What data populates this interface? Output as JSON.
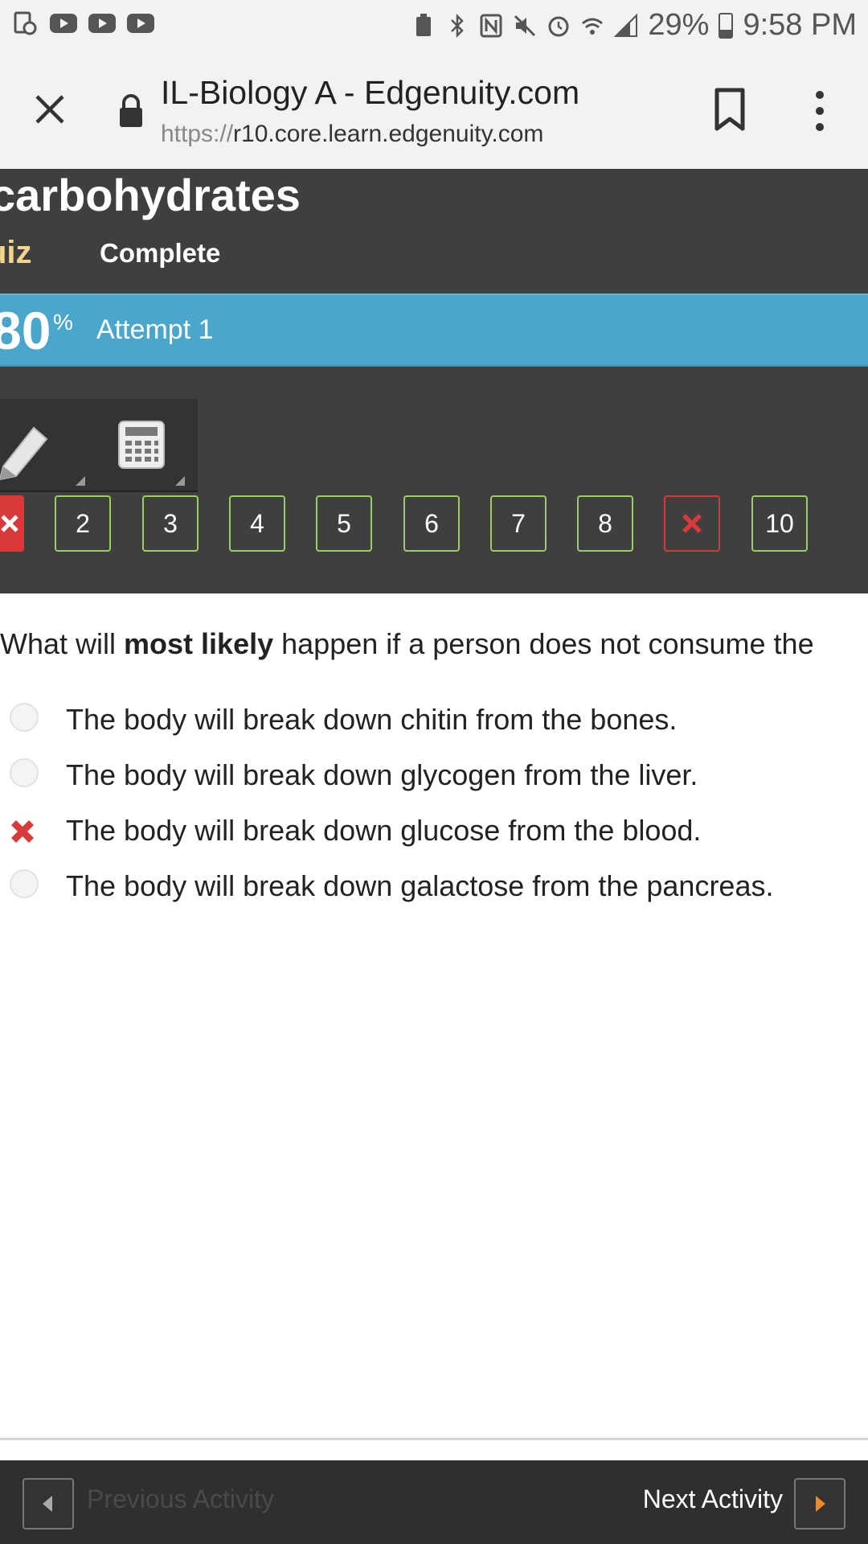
{
  "status_bar": {
    "battery": "29%",
    "battery_level": 0.29,
    "time": "9:58 PM"
  },
  "browser": {
    "page_title": "IL-Biology A - Edgenuity.com",
    "url_scheme": "https://",
    "url_host": "r10.core.learn.edgenuity.com"
  },
  "lesson": {
    "title": "carbohydrates",
    "type": "uiz",
    "status": "Complete"
  },
  "score": {
    "value": "80",
    "unit": "%",
    "attempt": "Attempt 1"
  },
  "questions": [
    {
      "label": "",
      "state": "wrong"
    },
    {
      "label": "2",
      "state": "correct"
    },
    {
      "label": "3",
      "state": "correct"
    },
    {
      "label": "4",
      "state": "correct"
    },
    {
      "label": "5",
      "state": "correct"
    },
    {
      "label": "6",
      "state": "correct"
    },
    {
      "label": "7",
      "state": "correct"
    },
    {
      "label": "8",
      "state": "correct"
    },
    {
      "label": "",
      "state": "wrong"
    },
    {
      "label": "10",
      "state": "correct"
    }
  ],
  "question": {
    "prefix": "What will ",
    "emphasis": "most likely",
    "suffix": " happen if a person does not consume the"
  },
  "answers": [
    {
      "text": "The body will break down chitin from the bones.",
      "state": "unselected"
    },
    {
      "text": "The body will break down glycogen from the liver.",
      "state": "unselected"
    },
    {
      "text": "The body will break down glucose from the blood.",
      "state": "wrong"
    },
    {
      "text": "The body will break down galactose from the pancreas.",
      "state": "unselected"
    }
  ],
  "footer": {
    "previous_label": "Previous Activity",
    "next_label": "Next Activity"
  },
  "colors": {
    "correct_border": "#9ccc65",
    "wrong": "#d63a3a",
    "score_bar": "#4aa7cb",
    "header_bg": "#3f3f3f",
    "next_arrow": "#f08a24"
  }
}
